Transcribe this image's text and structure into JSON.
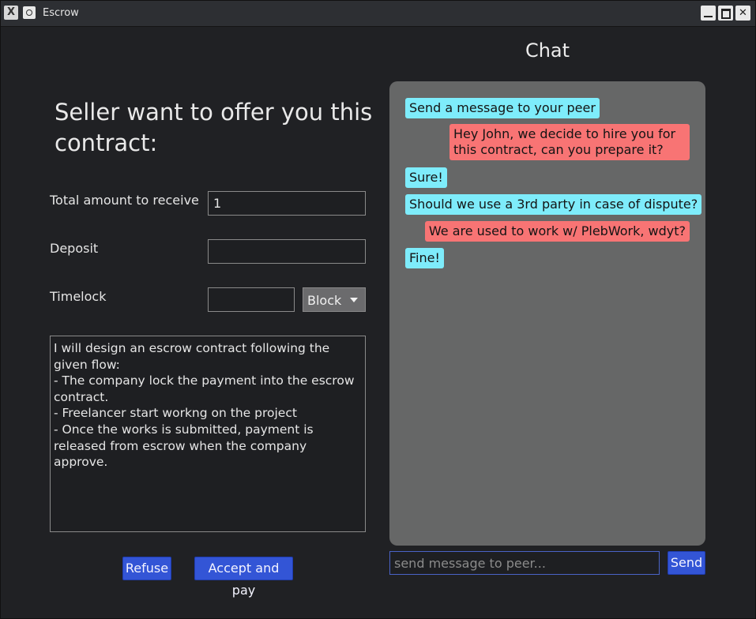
{
  "window": {
    "title": "Escrow",
    "app_icon": "app-logo-icon",
    "controls": [
      "minimize-icon",
      "maximize-icon",
      "close-icon"
    ]
  },
  "offer": {
    "heading": "Seller want to offer you this contract:",
    "fields": {
      "total_label": "Total amount to receive",
      "total_value": "1",
      "deposit_label": "Deposit",
      "deposit_value": "",
      "timelock_label": "Timelock",
      "timelock_value": "",
      "timelock_unit": "Block"
    },
    "description": "I will design an escrow contract following the given flow:\n- The company lock the payment into the escrow contract.\n- Freelancer start workng on the project\n- Once the works is submitted, payment is released from escrow when the company approve.",
    "refuse_label": "Refuse",
    "accept_label": "Accept and pay"
  },
  "chat": {
    "title": "Chat",
    "messages": [
      {
        "from": "peer",
        "text": "Send a message to your peer"
      },
      {
        "from": "self",
        "text": "Hey John, we decide to hire you for this contract, can you prepare it?"
      },
      {
        "from": "peer",
        "text": "Sure!"
      },
      {
        "from": "peer",
        "text": "Should we use a 3rd party in case of dispute?"
      },
      {
        "from": "self",
        "text": "We are used to work w/ PlebWork, wdyt?"
      },
      {
        "from": "peer",
        "text": "Fine!"
      }
    ],
    "input_placeholder": "send message to peer...",
    "send_label": "Send"
  },
  "colors": {
    "accent": "#3355d6",
    "peer_bubble": "#7eecfb",
    "self_bubble": "#f87474",
    "chat_panel": "#666767"
  }
}
